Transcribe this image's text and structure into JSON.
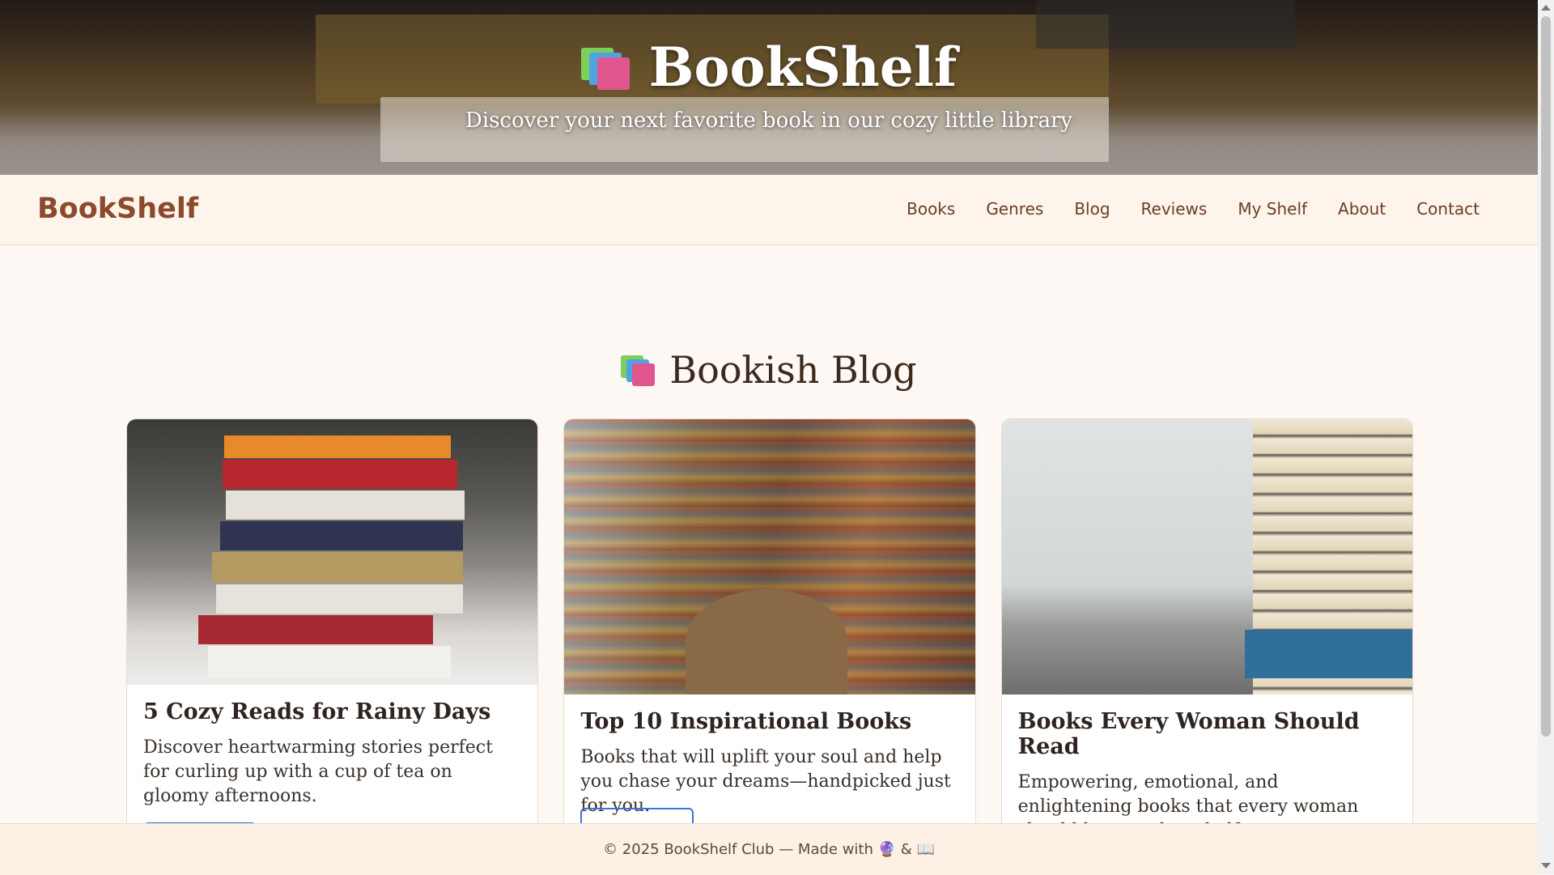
{
  "hero": {
    "title": "BookShelf",
    "subtitle": "Discover your next favorite book in our cozy little library",
    "icon": "books-icon"
  },
  "navbar": {
    "brand": "BookShelf",
    "links": [
      "Books",
      "Genres",
      "Blog",
      "Reviews",
      "My Shelf",
      "About",
      "Contact"
    ]
  },
  "blog": {
    "heading": "Bookish Blog",
    "posts": [
      {
        "title": "5 Cozy Reads for Rainy Days",
        "text": "Discover heartwarming stories perfect for curling up with a cup of tea on gloomy afternoons.",
        "image": "stacked-business-books-photo"
      },
      {
        "title": "Top 10 Inspirational Books",
        "text": "Books that will uplift your soul and help you chase your dreams—handpicked just for you.",
        "image": "curved-library-shelves-photo"
      },
      {
        "title": "Books Every Woman Should Read",
        "text": "Empowering, emotional, and enlightening books that every woman should have on her shelf.",
        "image": "old-books-stack-photo"
      }
    ]
  },
  "footer": {
    "text": "© 2025 BookShelf Club — Made with 🔮 & 📖"
  },
  "colors": {
    "brand": "#8b4a2b",
    "nav_text": "#6b3e24",
    "page_bg": "#fdf8f3",
    "button_border": "#3b73d9"
  }
}
